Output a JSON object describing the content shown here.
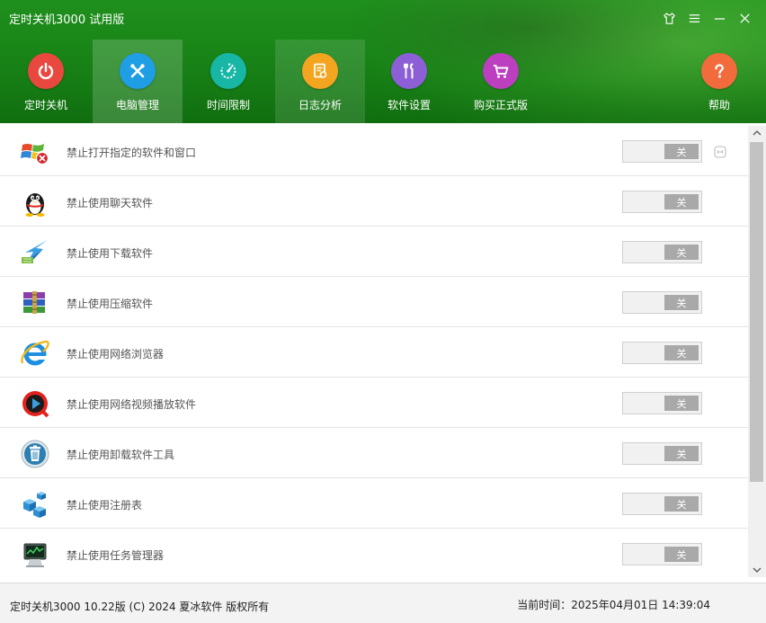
{
  "window": {
    "title": "定时关机3000 试用版",
    "controls": [
      "shirt-icon",
      "menu-icon",
      "minimize-icon",
      "close-icon"
    ]
  },
  "nav": {
    "items": [
      {
        "label": "定时关机",
        "icon": "power-icon",
        "color": "#e9483f",
        "state": "normal"
      },
      {
        "label": "电脑管理",
        "icon": "tools-icon",
        "color": "#1f9ee5",
        "state": "active"
      },
      {
        "label": "时间限制",
        "icon": "timer-icon",
        "color": "#17b6a5",
        "state": "normal"
      },
      {
        "label": "日志分析",
        "icon": "log-icon",
        "color": "#f4a51f",
        "state": "highlight"
      },
      {
        "label": "软件设置",
        "icon": "wrench-icon",
        "color": "#8d5fd6",
        "state": "normal"
      },
      {
        "label": "购买正式版",
        "icon": "cart-icon",
        "color": "#bb3fbf",
        "state": "normal"
      },
      {
        "label": "帮助",
        "icon": "help-icon",
        "color": "#f26b3d",
        "state": "normal"
      }
    ]
  },
  "list": {
    "rows": [
      {
        "label": "禁止打开指定的软件和窗口",
        "icon": "windows-block-icon",
        "toggle": "关"
      },
      {
        "label": "禁止使用聊天软件",
        "icon": "qq-penguin-icon",
        "toggle": "关"
      },
      {
        "label": "禁止使用下载软件",
        "icon": "thunder-bird-icon",
        "toggle": "关"
      },
      {
        "label": "禁止使用压缩软件",
        "icon": "winrar-books-icon",
        "toggle": "关"
      },
      {
        "label": "禁止使用网络浏览器",
        "icon": "ie-browser-icon",
        "toggle": "关"
      },
      {
        "label": "禁止使用网络视频播放软件",
        "icon": "video-player-icon",
        "toggle": "关"
      },
      {
        "label": "禁止使用卸载软件工具",
        "icon": "trash-bin-icon",
        "toggle": "关"
      },
      {
        "label": "禁止使用注册表",
        "icon": "registry-cubes-icon",
        "toggle": "关"
      },
      {
        "label": "禁止使用任务管理器",
        "icon": "task-manager-icon",
        "toggle": "关"
      }
    ]
  },
  "footer": {
    "copyright": "定时关机3000  10.22版  (C)  2024  夏冰软件  版权所有",
    "time_label": "当前时间：2025年04月01日  14:39:04"
  },
  "colors": {
    "header_green": "#1a8719",
    "toggle_off": "#a9a9a9"
  }
}
